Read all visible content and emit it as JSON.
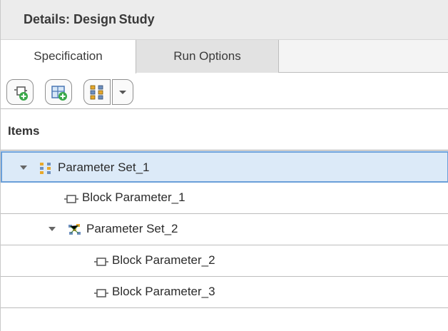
{
  "window": {
    "title": "Details: Design Study"
  },
  "tabs": [
    {
      "label": "Specification",
      "active": true
    },
    {
      "label": "Run Options",
      "active": false
    }
  ],
  "toolbar": {
    "buttons": [
      {
        "name": "add-block-parameter-button",
        "icon": "add-parameter-icon"
      },
      {
        "name": "add-parameter-set-button",
        "icon": "add-set-icon"
      },
      {
        "name": "parameter-set-type-button",
        "icon": "grid-set-icon"
      }
    ],
    "dropdown_icon": "chevron-down-icon"
  },
  "tree": {
    "header": "Items",
    "rows": [
      {
        "label": "Parameter Set_1",
        "level": 0,
        "expanded": true,
        "icon": "grid-set-icon",
        "selected": true
      },
      {
        "label": "Block Parameter_1",
        "level": 1,
        "icon": "block-parameter-icon"
      },
      {
        "label": "Parameter Set_2",
        "level": 1,
        "expanded": true,
        "icon": "random-set-icon"
      },
      {
        "label": "Block Parameter_2",
        "level": 2,
        "icon": "block-parameter-icon"
      },
      {
        "label": "Block Parameter_3",
        "level": 2,
        "icon": "block-parameter-icon"
      }
    ]
  },
  "colors": {
    "selection_fill": "#dceaf8",
    "selection_border": "#6a9fd9",
    "add_green": "#3aa84a"
  }
}
